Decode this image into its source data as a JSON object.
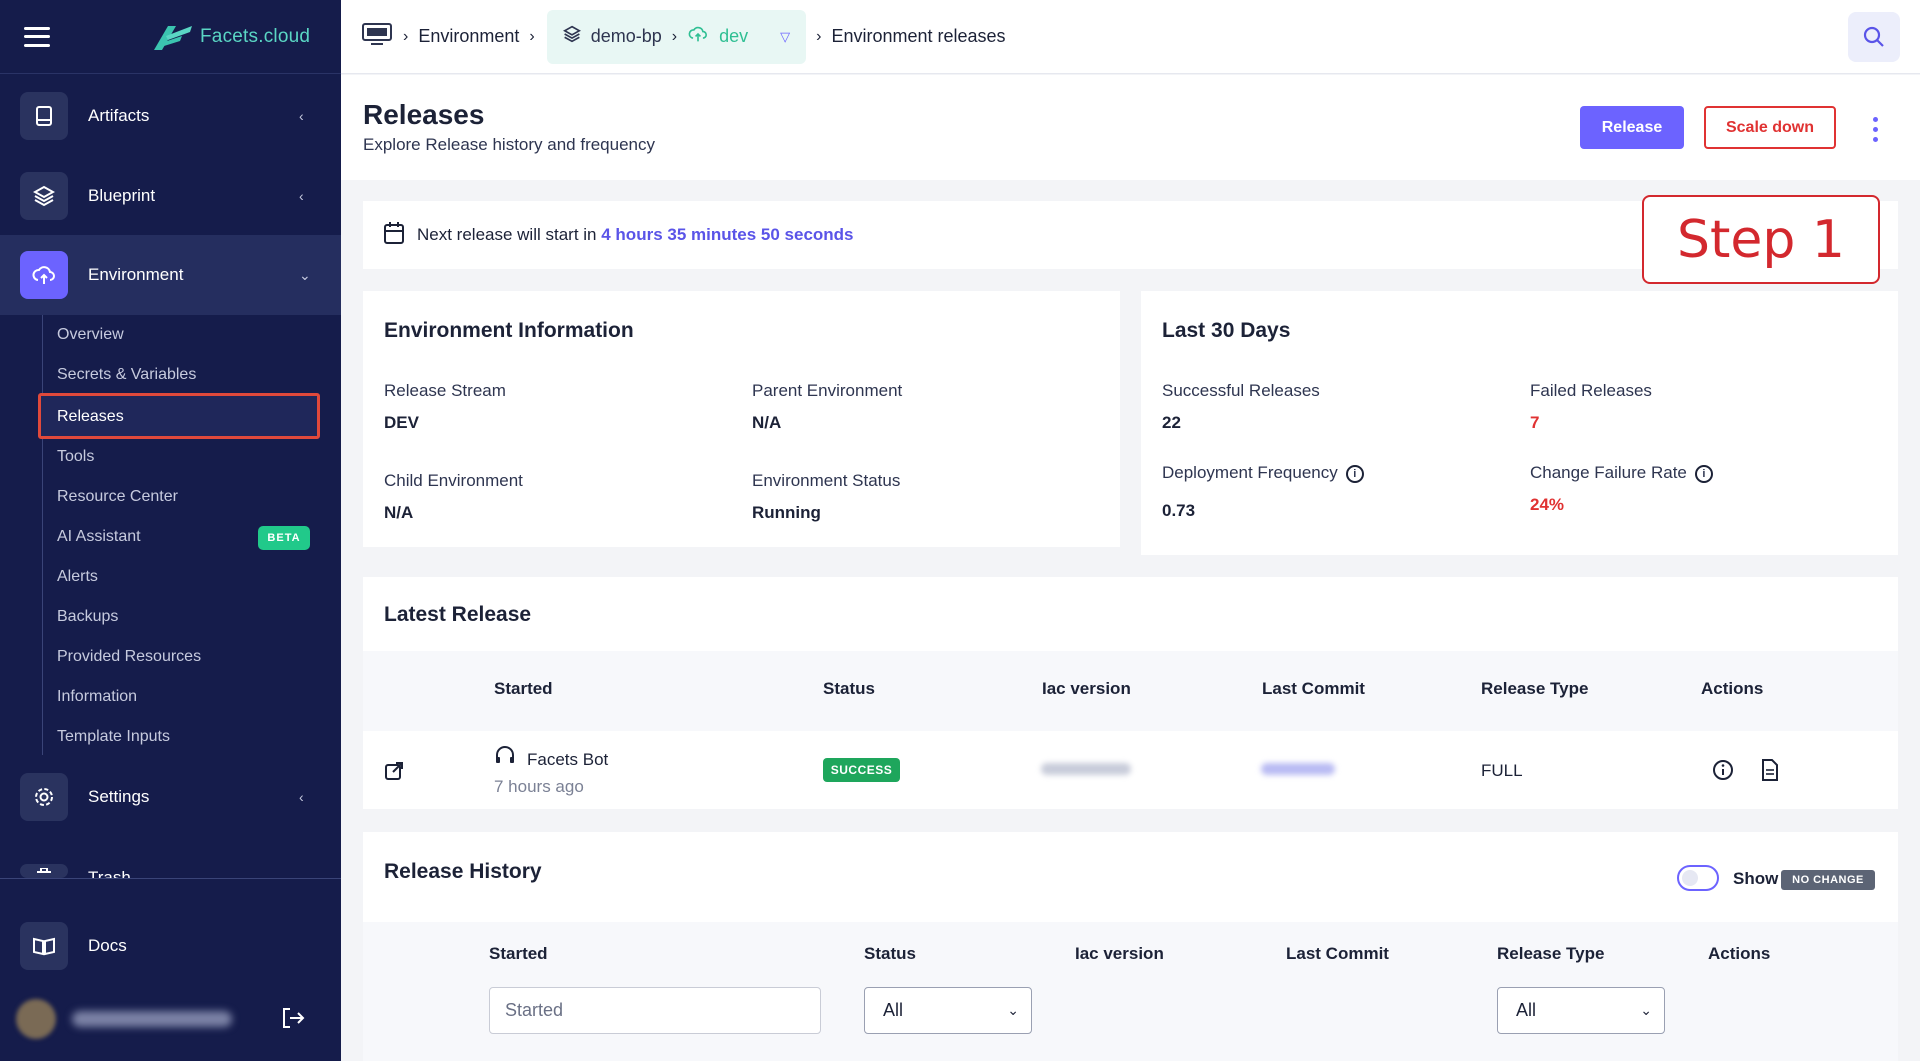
{
  "brand": {
    "name": "Facets",
    "suffix": ".cloud"
  },
  "sidebar": {
    "items": [
      {
        "label": "Artifacts"
      },
      {
        "label": "Blueprint"
      },
      {
        "label": "Environment"
      },
      {
        "label": "Settings"
      },
      {
        "label": "Trash"
      },
      {
        "label": "Docs"
      }
    ],
    "sub_items": [
      {
        "label": "Overview"
      },
      {
        "label": "Secrets & Variables"
      },
      {
        "label": "Releases"
      },
      {
        "label": "Tools"
      },
      {
        "label": "Resource Center"
      },
      {
        "label": "AI Assistant"
      },
      {
        "label": "Alerts"
      },
      {
        "label": "Backups"
      },
      {
        "label": "Provided Resources"
      },
      {
        "label": "Information"
      },
      {
        "label": "Template Inputs"
      }
    ],
    "beta_badge": "BETA",
    "selected_sub_item": "Releases"
  },
  "topbar": {
    "crumb_env": "Environment",
    "blueprint": "demo-bp",
    "env": "dev",
    "crumb_page": "Environment releases"
  },
  "page": {
    "title": "Releases",
    "subtitle": "Explore Release history and frequency",
    "release_button": "Release",
    "scale_down_button": "Scale down"
  },
  "notice": {
    "prefix": "Next release will start in",
    "time": "4 hours 35 minutes 50 seconds"
  },
  "step_label": "Step 1",
  "env_info": {
    "title": "Environment Information",
    "release_stream_label": "Release Stream",
    "release_stream": "DEV",
    "parent_env_label": "Parent Environment",
    "parent_env": "N/A",
    "child_env_label": "Child Environment",
    "child_env": "N/A",
    "env_status_label": "Environment Status",
    "env_status": "Running"
  },
  "last30": {
    "title": "Last 30 Days",
    "successful_label": "Successful Releases",
    "successful": "22",
    "failed_label": "Failed Releases",
    "failed": "7",
    "deploy_freq_label": "Deployment Frequency",
    "deploy_freq": "0.73",
    "cfr_label": "Change Failure Rate",
    "cfr": "24%"
  },
  "latest_release": {
    "title": "Latest Release",
    "columns": [
      "Started",
      "Status",
      "Iac version",
      "Last Commit",
      "Release Type",
      "Actions"
    ],
    "row": {
      "user": "Facets Bot",
      "time_ago": "7 hours ago",
      "status": "SUCCESS",
      "release_type": "FULL"
    }
  },
  "release_history": {
    "title": "Release History",
    "show_label": "Show",
    "no_change_badge": "NO CHANGE",
    "columns": [
      "Started",
      "Status",
      "Iac version",
      "Last Commit",
      "Release Type",
      "Actions"
    ],
    "started_placeholder": "Started",
    "status_filter": "All",
    "type_filter": "All"
  },
  "colors": {
    "accent": "#6c63ff",
    "sidebar": "#151c4b",
    "danger": "#e03232",
    "success": "#1ea65c"
  }
}
